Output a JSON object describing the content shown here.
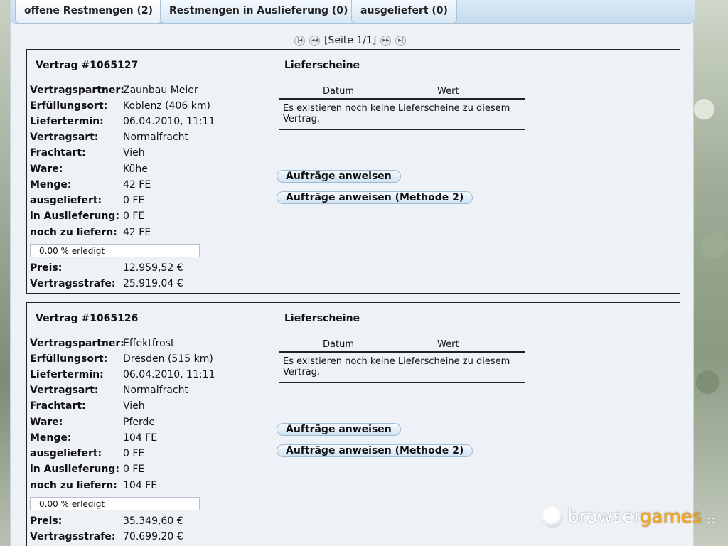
{
  "tabs": [
    {
      "label": "offene Restmengen (2)",
      "active": true
    },
    {
      "label": "Restmengen in Auslieferung (0)",
      "active": false
    },
    {
      "label": "ausgeliefert (0)",
      "active": false
    }
  ],
  "pager": {
    "text": "[Seite 1/1]"
  },
  "labels": {
    "partner": "Vertragspartner:",
    "ort": "Erfüllungsort:",
    "termin": "Liefertermin:",
    "art": "Vertragsart:",
    "fracht": "Frachtart:",
    "ware": "Ware:",
    "menge": "Menge:",
    "ausgeliefert": "ausgeliefert:",
    "in_auslieferung": "in Auslieferung:",
    "noch": "noch zu liefern:",
    "preis": "Preis:",
    "strafe": "Vertragsstrafe:",
    "lieferscheine": "Lieferscheine",
    "datum": "Datum",
    "wert": "Wert",
    "no_lieferscheine": "Es existieren noch keine Lieferscheine zu diesem Vertrag.",
    "btn1": "Aufträge anweisen",
    "btn2": "Aufträge anweisen (Methode 2)"
  },
  "contracts": [
    {
      "title": "Vertrag #1065127",
      "partner": "Zaunbau Meier",
      "ort": "Koblenz (406 km)",
      "termin": "06.04.2010, 11:11",
      "art": "Normalfracht",
      "fracht": "Vieh",
      "ware": "Kühe",
      "menge": "42 FE",
      "ausgeliefert": "0 FE",
      "in_auslieferung": "0 FE",
      "noch": "42 FE",
      "progress_text": "0.00 % erledigt",
      "progress": 0,
      "preis": "12.959,52 €",
      "strafe": "25.919,04 €"
    },
    {
      "title": "Vertrag #1065126",
      "partner": "Effektfrost",
      "ort": "Dresden (515 km)",
      "termin": "06.04.2010, 11:11",
      "art": "Normalfracht",
      "fracht": "Vieh",
      "ware": "Pferde",
      "menge": "104 FE",
      "ausgeliefert": "0 FE",
      "in_auslieferung": "0 FE",
      "noch": "104 FE",
      "progress_text": "0.00 % erledigt",
      "progress": 0,
      "preis": "35.349,60 €",
      "strafe": "70.699,20 €"
    }
  ],
  "watermark": {
    "part1": "browser",
    "part2": "games",
    "part3": ".de"
  }
}
